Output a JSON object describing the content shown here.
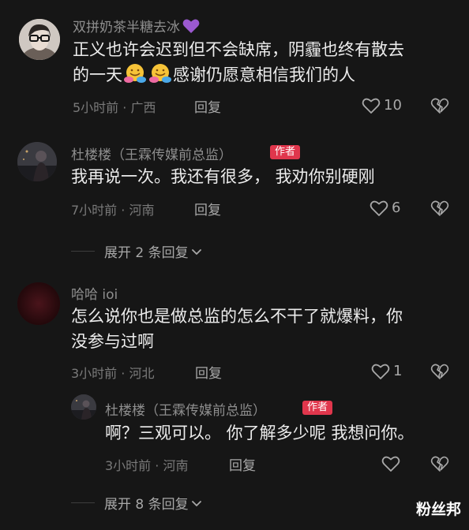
{
  "comments": [
    {
      "username": "双拼奶茶半糖去冰",
      "username_emoji": "purple-heart",
      "text_line1": "正义也许会迟到但不会缺席，阴霾也终有散去",
      "text_line2_prefix": "的一天",
      "text_line2_emojis": [
        "hugging-face",
        "hugging-face"
      ],
      "text_line2_suffix": "感谢仍愿意相信我们的人",
      "time_location": "5小时前 · 广西",
      "reply_label": "回复",
      "likes": "10",
      "like_icon": "heart-outline-icon",
      "dislike_icon": "broken-heart-icon"
    },
    {
      "username": "杜楼楼（王霖传媒前总监）",
      "badge": "作者",
      "text_line1": "我再说一次。我还有很多， 我劝你别硬刚",
      "time_location": "7小时前 · 河南",
      "reply_label": "回复",
      "likes": "6",
      "expand_label": "展开 2 条回复"
    },
    {
      "username": "哈哈 ioi",
      "text_line1": "怎么说你也是做总监的怎么不干了就爆料，你",
      "text_line2": "没参与过啊",
      "time_location": "3小时前 · 河北",
      "reply_label": "回复",
      "likes": "1"
    }
  ],
  "reply": {
    "username": "杜楼楼（王霖传媒前总监）",
    "badge": "作者",
    "text_line1": "啊？三观可以。 你了解多少呢 我想问你。",
    "time_location": "3小时前 · 河南",
    "reply_label": "回复",
    "likes": "",
    "expand_label": "展开 8 条回复"
  },
  "watermark": "粉丝邦",
  "colors": {
    "background": "#161616",
    "badge": "#e0364c",
    "username": "#8e8e8e",
    "content": "#ececec",
    "meta": "#7a7a7a",
    "emoji_heart": "#9b59d0"
  }
}
